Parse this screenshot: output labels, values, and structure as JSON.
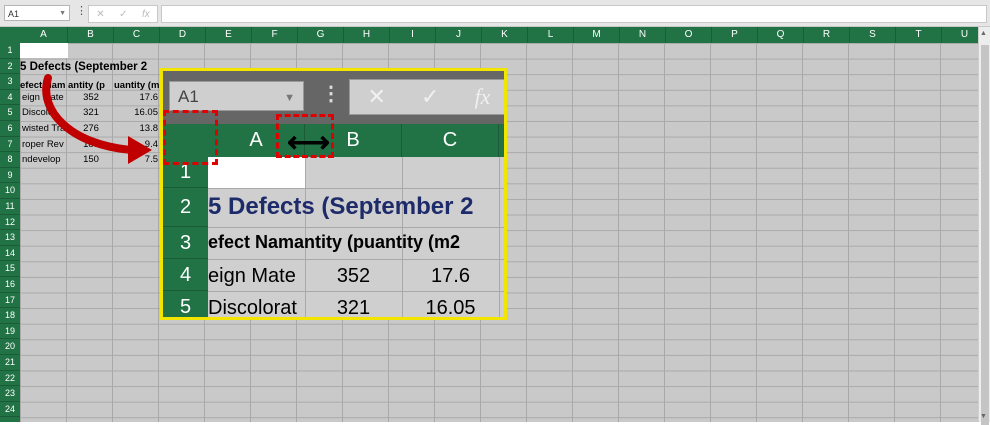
{
  "formula_bar": {
    "name_box": "A1",
    "more_icon": "⋮",
    "cancel_icon": "✕",
    "enter_icon": "✓",
    "fx_icon": "fx",
    "formula_value": ""
  },
  "columns": [
    "A",
    "B",
    "C",
    "D",
    "E",
    "F",
    "G",
    "H",
    "I",
    "J",
    "K",
    "L",
    "M",
    "N",
    "O",
    "P",
    "Q",
    "R",
    "S",
    "T",
    "U"
  ],
  "rows": [
    "1",
    "2",
    "3",
    "4",
    "5",
    "6",
    "7",
    "8",
    "9",
    "10",
    "11",
    "12",
    "13",
    "14",
    "15",
    "16",
    "17",
    "18",
    "19",
    "20",
    "21",
    "22",
    "23",
    "24"
  ],
  "sheet": {
    "title": "5 Defects (September 2",
    "headers": [
      "efect Nam",
      "antity (p",
      "uantity (m"
    ],
    "data": [
      [
        "eign Mate",
        "352",
        "17.6"
      ],
      [
        "Discolor",
        "321",
        "16.05"
      ],
      [
        "wisted Tra",
        "276",
        "13.8"
      ],
      [
        "roper Rev",
        "188",
        "9.4"
      ],
      [
        "ndevelop",
        "150",
        "7.5"
      ]
    ]
  },
  "zoom": {
    "name_box": "A1",
    "columns": [
      "A",
      "B",
      "C"
    ],
    "rows": [
      "1",
      "2",
      "3",
      "4",
      "5"
    ],
    "title": "5 Defects (September 2",
    "header_text": "efect Namantity (puantity (m2",
    "data": [
      [
        "eign Mate",
        "352",
        "17.6"
      ],
      [
        "Discolorat",
        "321",
        "16.05"
      ]
    ]
  },
  "colors": {
    "header_green": "#217346",
    "callout_red": "#e00000",
    "inset_border": "#f2e600",
    "title_blue": "#1e2b6b"
  }
}
